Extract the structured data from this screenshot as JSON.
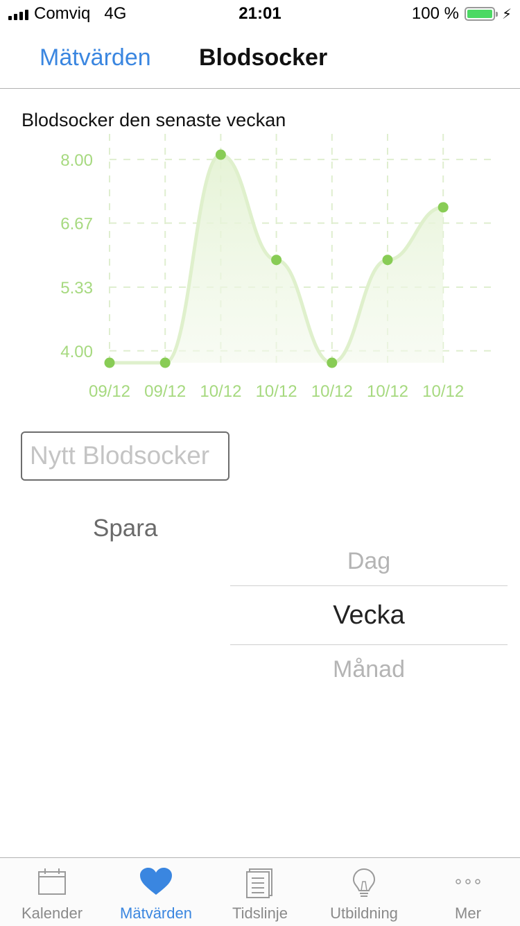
{
  "status": {
    "carrier": "Comviq",
    "network": "4G",
    "time": "21:01",
    "battery": "100 %",
    "battery_level": 1.0
  },
  "nav": {
    "back_label": "Mätvärden",
    "title": "Blodsocker"
  },
  "chart_data": {
    "type": "line",
    "title": "Blodsocker den senaste veckan",
    "categories": [
      "09/12",
      "09/12",
      "10/12",
      "10/12",
      "10/12",
      "10/12",
      "10/12"
    ],
    "values": [
      3.75,
      3.75,
      8.1,
      5.9,
      3.75,
      5.9,
      7.0
    ],
    "yticks": [
      "8.00",
      "6.67",
      "5.33",
      "4.00"
    ],
    "ylim": [
      3.75,
      8.1
    ],
    "grid": true,
    "smooth": true,
    "filled": true,
    "line_color": "#dff0cc",
    "point_color": "#88cc55",
    "label_color": "#a6d97f"
  },
  "form": {
    "input_placeholder": "Nytt Blodsocker",
    "save_label": "Spara"
  },
  "picker": {
    "options": [
      "Dag",
      "Vecka",
      "Månad"
    ],
    "selected": "Vecka"
  },
  "tabs": [
    {
      "label": "Kalender",
      "icon": "calendar-icon"
    },
    {
      "label": "Mätvärden",
      "icon": "heart-icon"
    },
    {
      "label": "Tidslinje",
      "icon": "document-icon"
    },
    {
      "label": "Utbildning",
      "icon": "lightbulb-icon"
    },
    {
      "label": "Mer",
      "icon": "more-icon"
    }
  ],
  "active_tab": "Mätvärden",
  "colors": {
    "accent": "#3a86e0",
    "battery": "#4cd964"
  }
}
